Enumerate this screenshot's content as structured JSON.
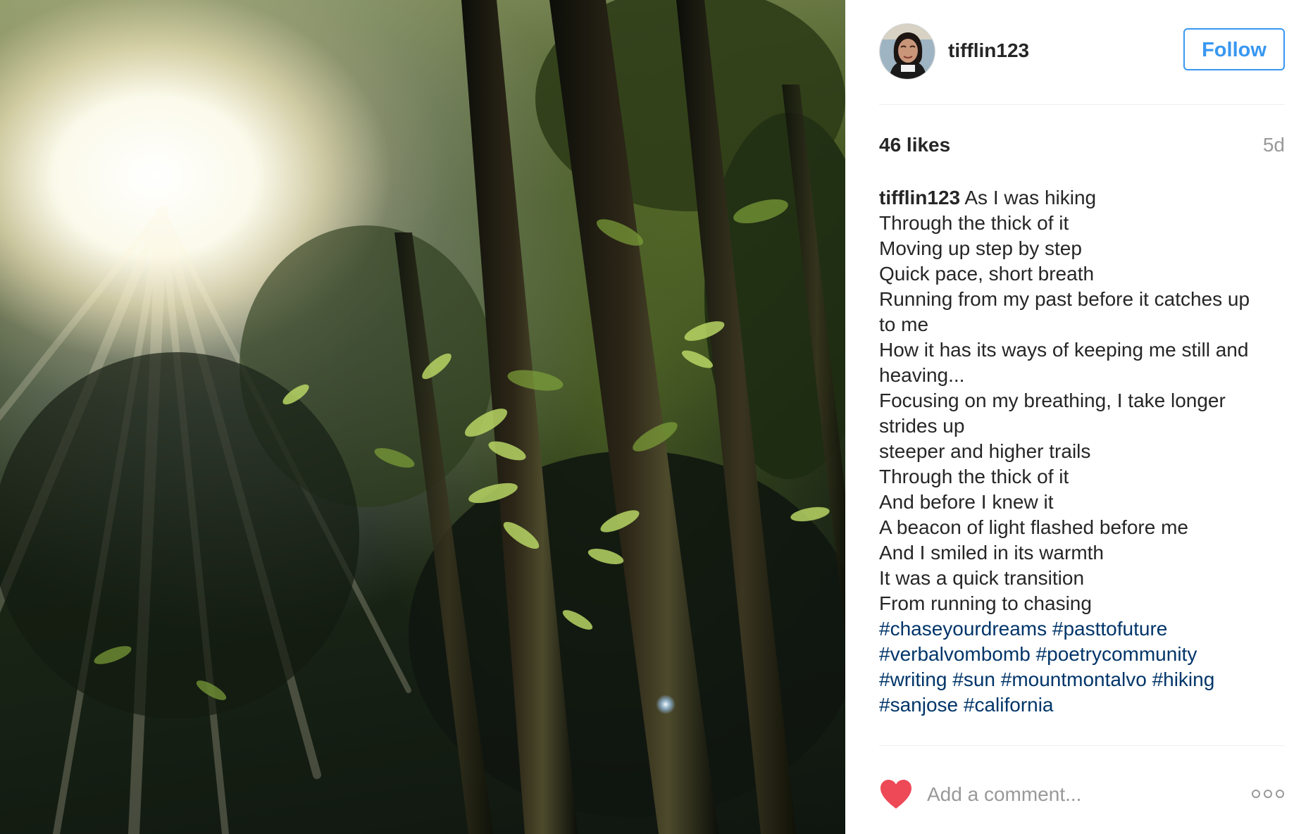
{
  "post": {
    "photo_alt": "Sunlight shining through a redwood forest canopy",
    "author": {
      "username": "tifflin123",
      "avatar": "profile-photo"
    },
    "follow_label": "Follow",
    "likes_text": "46 likes",
    "time_ago": "5d",
    "caption": {
      "author": "tifflin123",
      "lines": [
        "As I was hiking",
        "Through the thick of it",
        "Moving up step by step",
        "Quick pace, short breath",
        "Running from my past before it catches up",
        "to me",
        "How it has its ways of keeping me still and",
        "heaving...",
        "Focusing on my breathing, I take longer",
        "strides up",
        "steeper and higher trails",
        "Through the thick of it",
        "And before I knew it",
        "A beacon of light flashed before me",
        "And I smiled in its warmth",
        "It was a quick transition",
        "From running to chasing"
      ],
      "hashtag_lines": [
        [
          "#chaseyourdreams",
          "#pasttofuture"
        ],
        [
          "#verbalvombomb",
          "#poetrycommunity"
        ],
        [
          "#writing",
          "#sun",
          "#mountmontalvo",
          "#hiking"
        ],
        [
          "#sanjose",
          "#california"
        ]
      ]
    },
    "comment_placeholder": "Add a comment...",
    "icons": {
      "like": "heart-icon",
      "more": "more-options-icon"
    },
    "colors": {
      "link_blue": "#3897f0",
      "hashtag": "#003569",
      "heart": "#ed4956",
      "muted": "#999999",
      "text": "#262626"
    }
  }
}
